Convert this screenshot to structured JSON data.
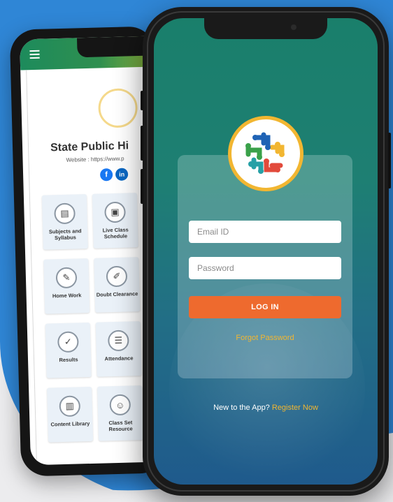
{
  "colors": {
    "background_blue": "#2f86d6",
    "screen_teal": "#1a7f6b",
    "screen_blue": "#1f5a8c",
    "login_orange": "#ee6a2e",
    "link_gold": "#f2b631"
  },
  "back_phone": {
    "menu_icon": "hamburger-icon",
    "school_name": "State Public Hi",
    "website": "Website : https://www.p",
    "social": {
      "facebook": "f",
      "linkedin": "in"
    },
    "tiles": [
      {
        "label": "Subjects and Syllabus",
        "icon": "book-icon",
        "glyph": "▤"
      },
      {
        "label": "Live Class Schedule",
        "icon": "video-class-icon",
        "glyph": "▣"
      },
      {
        "label": "Home Work",
        "icon": "student-desk-icon",
        "glyph": "✎"
      },
      {
        "label": "Doubt Clearance",
        "icon": "doubt-icon",
        "glyph": "✐"
      },
      {
        "label": "Results",
        "icon": "results-icon",
        "glyph": "✓"
      },
      {
        "label": "Attendance",
        "icon": "clipboard-icon",
        "glyph": "☰"
      },
      {
        "label": "Content Library",
        "icon": "library-icon",
        "glyph": "▥"
      },
      {
        "label": "Class Set Resource",
        "icon": "resource-person-icon",
        "glyph": "☺"
      }
    ]
  },
  "login": {
    "email_placeholder": "Email ID",
    "password_placeholder": "Password",
    "login_label": "LOG IN",
    "forgot_label": "Forgot Password",
    "new_to_app": "New to the App?",
    "register_label": "Register Now"
  }
}
